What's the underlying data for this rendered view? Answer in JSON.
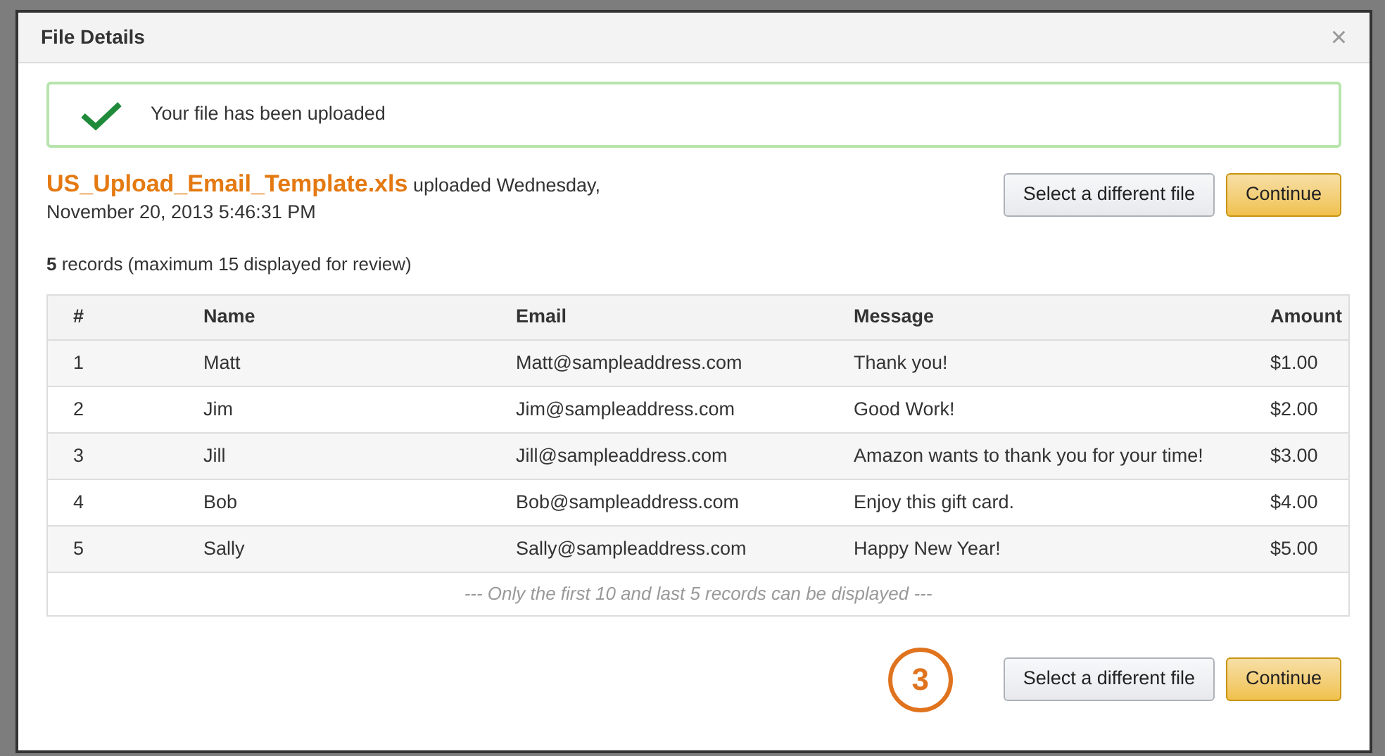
{
  "dialog": {
    "title": "File Details",
    "close": "×"
  },
  "alert": {
    "message": "Your file has been uploaded"
  },
  "file": {
    "name": "US_Upload_Email_Template.xls",
    "uploaded": "uploaded Wednesday,",
    "date": "November 20, 2013 5:46:31 PM"
  },
  "buttons": [
    "Select a different file",
    "Continue"
  ],
  "summary": "**5** records (maximum 15 displayed for review)",
  "table": {
    "columns": [
      "#",
      "Name",
      "Email",
      "Message",
      "Amount"
    ],
    "rows": [
      [
        "1",
        "Matt",
        "Matt@sampleaddress.com",
        "Thank you!",
        "$1.00"
      ],
      [
        "2",
        "Jim",
        "Jim@sampleaddress.com",
        "Good Work!",
        "$2.00"
      ],
      [
        "3",
        "Jill",
        "Jill@sampleaddress.com",
        "Amazon wants to thank you for your time!",
        "$3.00"
      ],
      [
        "4",
        "Bob",
        "Bob@sampleaddress.com",
        "Enjoy this gift card.",
        "$4.00"
      ],
      [
        "5",
        "Sally",
        "Sally@sampleaddress.com",
        "Happy New Year!",
        "$5.00"
      ]
    ],
    "footer": "--- Only the first 10 and last 5 records can be displayed ---"
  },
  "step_marker": "3",
  "bottom_buttons": [
    "Select a different file",
    "Continue"
  ]
}
